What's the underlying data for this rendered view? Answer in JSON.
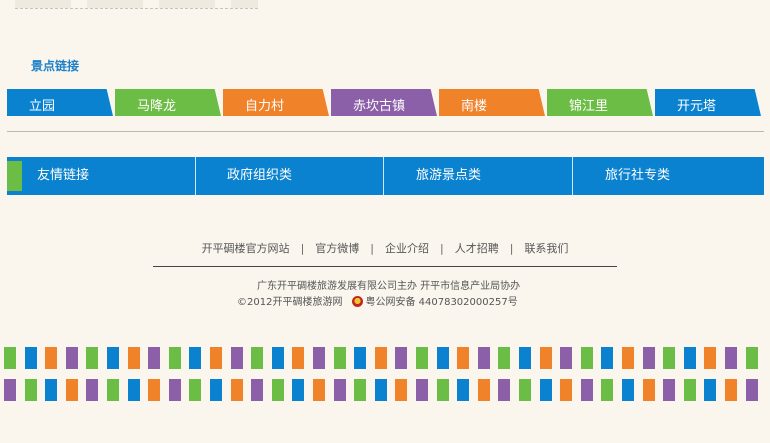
{
  "scenic": {
    "title": "景点链接",
    "items": [
      {
        "label": "立园",
        "color": "#0a82cf"
      },
      {
        "label": "马降龙",
        "color": "#6cbd45"
      },
      {
        "label": "自力村",
        "color": "#f0822a"
      },
      {
        "label": "赤坎古镇",
        "color": "#8c5fa9"
      },
      {
        "label": "南楼",
        "color": "#f0822a"
      },
      {
        "label": "锦江里",
        "color": "#6cbd45"
      },
      {
        "label": "开元塔",
        "color": "#0a82cf"
      }
    ]
  },
  "friend_links": {
    "items": [
      "友情链接",
      "政府组织类",
      "旅游景点类",
      "旅行社专类"
    ],
    "bar_color": "#0a82cf",
    "accent_color": "#6cbd45"
  },
  "footer": {
    "links": [
      "开平碉楼官方网站",
      "官方微博",
      "企业介绍",
      "人才招聘",
      "联系我们"
    ],
    "line1": "广东开平碉楼旅游发展有限公司主办 开平市信息产业局协办",
    "copyright": "©2012开平碉楼旅游网",
    "police": "粤公网安备 44078302000257号"
  },
  "stripe_colors": [
    "#0a82cf",
    "#f0822a",
    "#8c5fa9",
    "#6cbd45"
  ]
}
